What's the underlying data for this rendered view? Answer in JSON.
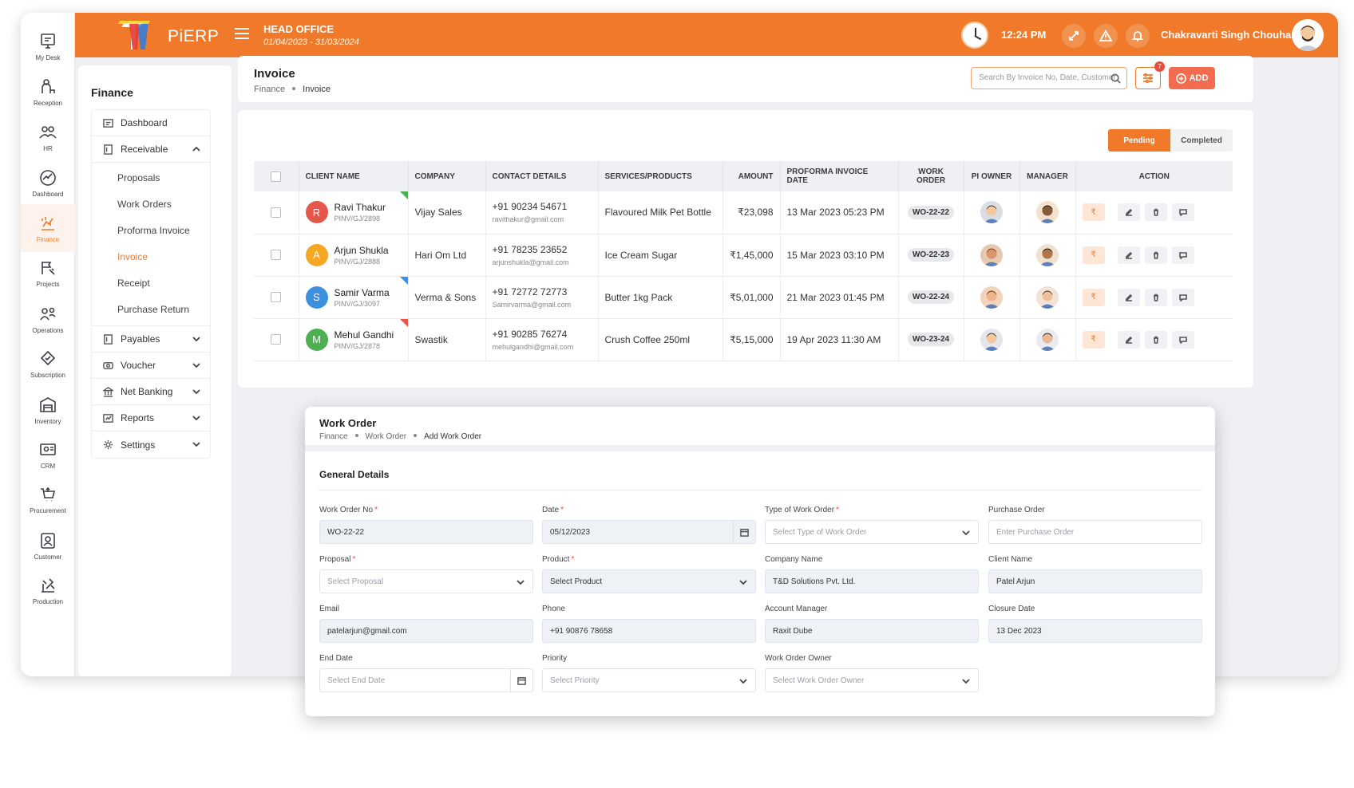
{
  "rail": [
    {
      "label": "My Desk",
      "icon": "my-desk-icon"
    },
    {
      "label": "Reception",
      "icon": "reception-icon"
    },
    {
      "label": "HR",
      "icon": "hr-icon"
    },
    {
      "label": "Dashboard",
      "icon": "dashboard-icon"
    },
    {
      "label": "Finance",
      "icon": "finance-icon"
    },
    {
      "label": "Projects",
      "icon": "projects-icon"
    },
    {
      "label": "Operations",
      "icon": "operations-icon"
    },
    {
      "label": "Subscription",
      "icon": "subscription-icon"
    },
    {
      "label": "Inventory",
      "icon": "inventory-icon"
    },
    {
      "label": "CRM",
      "icon": "crm-icon"
    },
    {
      "label": "Procurement",
      "icon": "procurement-icon"
    },
    {
      "label": "Customer",
      "icon": "customer-icon"
    },
    {
      "label": "Production",
      "icon": "production-icon"
    }
  ],
  "header": {
    "logo": "PiERP",
    "office": "HEAD OFFICE",
    "period": "01/04/2023 - 31/03/2024",
    "time": "12:24 PM",
    "user": "Chakravarti Singh Chouhan"
  },
  "sidebar": {
    "title": "Finance",
    "dashboard": "Dashboard",
    "receivable": "Receivable",
    "sub": [
      "Proposals",
      "Work Orders",
      "Proforma Invoice",
      "Invoice",
      "Receipt",
      "Purchase Return"
    ],
    "payables": "Payables",
    "voucher": "Voucher",
    "netbanking": "Net Banking",
    "reports": "Reports",
    "settings": "Settings"
  },
  "page": {
    "title": "Invoice",
    "crumb1": "Finance",
    "crumb2": "Invoice",
    "search_placeholder": "Search By Invoice No, Date, Customer",
    "filter_badge": "7",
    "add": "ADD",
    "tab_pending": "Pending",
    "tab_completed": "Completed"
  },
  "table": {
    "headers": [
      "CLIENT NAME",
      "COMPANY",
      "CONTACT DETAILS",
      "SERVICES/PRODUCTS",
      "AMOUNT",
      "PROFORMA INVOICE DATE",
      "WORK ORDER",
      "PI OWNER",
      "MANAGER",
      "ACTION"
    ],
    "rows": [
      {
        "initial": "R",
        "name": "Ravi Thakur",
        "id": "PINV/GJ/2898",
        "company": "Vijay Sales",
        "phone": "+91 90234 54671",
        "email": "ravithakur@gmail.com",
        "product": "Flavoured Milk Pet Bottle",
        "amount": "₹23,098",
        "date": "13 Mar 2023 05:23 PM",
        "wo": "WO-22-22",
        "color": "#e5564b",
        "corner": "#4caf50"
      },
      {
        "initial": "A",
        "name": "Arjun Shukla",
        "id": "PINV/GJ/2888",
        "company": "Hari Om Ltd",
        "phone": "+91 78235 23652",
        "email": "arjunshukla@gmail.com",
        "product": "Ice Cream Sugar",
        "amount": "₹1,45,000",
        "date": "15 Mar 2023 03:10 PM",
        "wo": "WO-22-23",
        "color": "#f5a623",
        "corner": ""
      },
      {
        "initial": "S",
        "name": "Samir Varma",
        "id": "PINV/GJ/3097",
        "company": "Verma & Sons",
        "phone": "+91 72772 72773",
        "email": "Samirvarma@gmail.com",
        "product": "Butter 1kg Pack",
        "amount": "₹5,01,000",
        "date": "21 Mar 2023 01:45 PM",
        "wo": "WO-22-24",
        "color": "#3d8fe0",
        "corner": "#3d8fe0"
      },
      {
        "initial": "M",
        "name": "Mehul Gandhi",
        "id": "PINV/GJ/2878",
        "company": "Swastik",
        "phone": "+91 90285 76274",
        "email": "mehulgandhi@gmail.com",
        "product": "Crush Coffee 250ml",
        "amount": "₹5,15,000",
        "date": "19 Apr 2023 11:30 AM",
        "wo": "WO-23-24",
        "color": "#4caf50",
        "corner": "#e5564b"
      }
    ],
    "rupee": "₹"
  },
  "workorder": {
    "title": "Work Order",
    "crumb1": "Finance",
    "crumb2": "Work Order",
    "crumb3": "Add Work Order",
    "section": "General Details",
    "fields": {
      "wo_no": {
        "label": "Work Order No",
        "value": "WO-22-22"
      },
      "date": {
        "label": "Date",
        "value": "05/12/2023"
      },
      "type": {
        "label": "Type of Work Order",
        "value": "Select Type of Work Order"
      },
      "po": {
        "label": "Purchase Order",
        "value": "Enter Purchase Order"
      },
      "proposal": {
        "label": "Proposal",
        "value": "Select Proposal"
      },
      "product": {
        "label": "Product",
        "value": "Select Product"
      },
      "company": {
        "label": "Company Name",
        "value": "T&D Solutions Pvt. Ltd."
      },
      "client": {
        "label": "Client Name",
        "value": "Patel Arjun"
      },
      "email": {
        "label": "Email",
        "value": "patelarjun@gmail.com"
      },
      "phone": {
        "label": "Phone",
        "value": "+91 90876 78658"
      },
      "manager": {
        "label": "Account Manager",
        "value": "Raxit Dube"
      },
      "closure": {
        "label": "Closure Date",
        "value": "13 Dec 2023"
      },
      "enddate": {
        "label": "End Date",
        "value": "Select End Date"
      },
      "priority": {
        "label": "Priority",
        "value": "Select Priority"
      },
      "owner": {
        "label": "Work Order Owner",
        "value": "Select Work Order Owner"
      }
    },
    "required": "*"
  },
  "colors": {
    "accent": "#f07a2a",
    "add": "#f26d4f"
  }
}
